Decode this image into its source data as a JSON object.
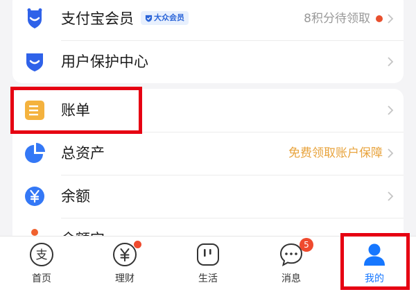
{
  "list_group_1": {
    "items": [
      {
        "label": "支付宝会员",
        "badge": "大众会员",
        "right_text": "8积分待领取"
      },
      {
        "label": "用户保护中心"
      }
    ]
  },
  "list_group_2": {
    "items": [
      {
        "label": "账单"
      },
      {
        "label": "总资产",
        "right_text": "免费领取账户保障"
      },
      {
        "label": "余额"
      },
      {
        "label": "余额宝"
      }
    ]
  },
  "tabbar": {
    "tabs": [
      {
        "label": "首页"
      },
      {
        "label": "理财"
      },
      {
        "label": "生活"
      },
      {
        "label": "消息",
        "count": "5"
      },
      {
        "label": "我的"
      }
    ]
  },
  "icons": {
    "member": "member-shield-icon",
    "protection": "protection-shield-icon",
    "bill": "bill-list-icon",
    "assets": "pie-chart-icon",
    "balance": "yuan-coin-icon",
    "yuebao": "yuebao-icon",
    "home": "alipay-logo-icon",
    "wealth": "yuan-circle-icon",
    "life": "life-square-icon",
    "messages": "chat-bubble-icon",
    "me": "person-icon"
  },
  "colors": {
    "brand_blue": "#1677ff",
    "highlight_red": "#e60012",
    "promo_orange": "#e8a33c",
    "bill_yellow": "#f4b23e"
  }
}
